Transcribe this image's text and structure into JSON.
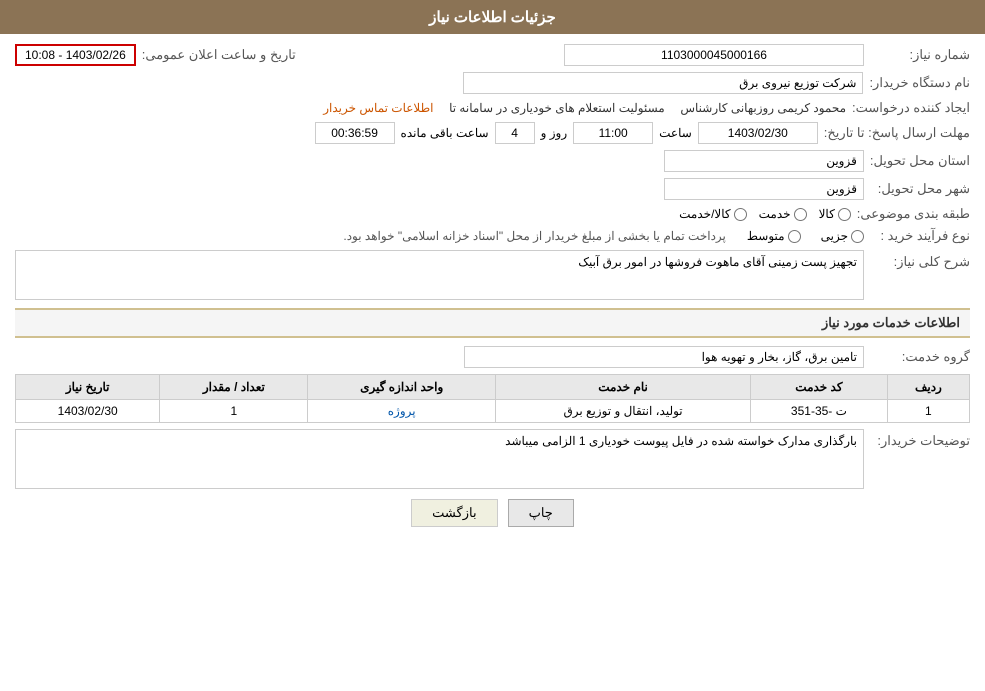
{
  "header": {
    "title": "جزئیات اطلاعات نیاز"
  },
  "fields": {
    "need_number_label": "شماره نیاز:",
    "need_number_value": "1103000045000166",
    "buyer_label": "نام دستگاه خریدار:",
    "buyer_value": "شرکت توزیع نیروی برق",
    "creator_label": "ایجاد کننده درخواست:",
    "creator_person": "محمود کریمی روزبهانی کارشناس",
    "creator_responsibility": "مسئولیت استعلام های خودیاری در سامانه تا",
    "contact_link": "اطلاعات تماس خریدار",
    "deadline_label": "مهلت ارسال پاسخ: تا تاریخ:",
    "deadline_date": "1403/02/30",
    "deadline_time_label": "ساعت",
    "deadline_time": "11:00",
    "deadline_days_label": "روز و",
    "deadline_days": "4",
    "deadline_remaining_label": "ساعت باقی مانده",
    "deadline_remaining": "00:36:59",
    "province_label": "استان محل تحویل:",
    "province_value": "قزوین",
    "city_label": "شهر محل تحویل:",
    "city_value": "قزوین",
    "category_label": "طبقه بندی موضوعی:",
    "radio_goods": "کالا",
    "radio_service": "خدمت",
    "radio_goods_service": "کالا/خدمت",
    "purchase_type_label": "نوع فرآیند خرید :",
    "radio_partial": "جزیی",
    "radio_medium": "متوسط",
    "purchase_note": "پرداخت تمام یا بخشی از مبلغ خریدار از محل \"اسناد خزانه اسلامی\" خواهد بود.",
    "description_label": "شرح کلی نیاز:",
    "description_value": "تجهیز پست زمینی آقای ماهوت فروشها در امور برق آبیک",
    "services_title": "اطلاعات خدمات مورد نیاز",
    "service_group_label": "گروه خدمت:",
    "service_group_value": "تامین برق، گاز، بخار و تهویه هوا",
    "table_headers": {
      "row_num": "ردیف",
      "service_code": "کد خدمت",
      "service_name": "نام خدمت",
      "unit": "واحد اندازه گیری",
      "count": "تعداد / مقدار",
      "date": "تاریخ نیاز"
    },
    "table_rows": [
      {
        "row_num": "1",
        "service_code": "ت -35-351",
        "service_name": "تولید، انتقال و توزیع برق",
        "unit": "پروژه",
        "count": "1",
        "date": "1403/02/30"
      }
    ],
    "buyer_notes_label": "توضیحات خریدار:",
    "buyer_notes_value": "بارگذاری مدارک خواسته شده در فایل پیوست خودیاری 1 الزامی میباشد",
    "btn_print": "چاپ",
    "btn_back": "بازگشت",
    "date_display": "1403/02/26 - 10:08",
    "date_display_label": "تاریخ و ساعت اعلان عمومی:"
  }
}
